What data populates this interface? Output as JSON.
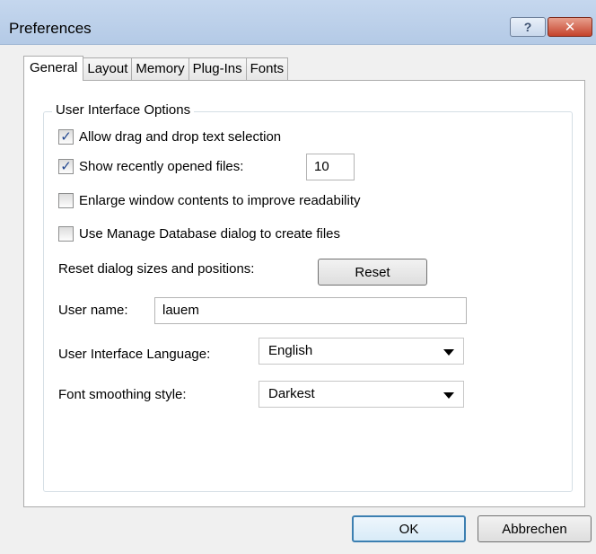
{
  "window": {
    "title": "Preferences"
  },
  "titlebar": {
    "help_icon": "question-mark-icon",
    "close_icon": "close-icon"
  },
  "tabs": [
    {
      "label": "General",
      "active": true
    },
    {
      "label": "Layout",
      "active": false
    },
    {
      "label": "Memory",
      "active": false
    },
    {
      "label": "Plug-Ins",
      "active": false
    },
    {
      "label": "Fonts",
      "active": false
    }
  ],
  "group": {
    "label": "User Interface Options",
    "checkboxes": [
      {
        "label": "Allow drag and drop text selection",
        "checked": true
      },
      {
        "label": "Show recently opened files:",
        "checked": true
      },
      {
        "label": "Enlarge window contents to improve readability",
        "checked": false
      },
      {
        "label": "Use Manage Database dialog to create files",
        "checked": false
      }
    ],
    "recent_files_count": "10",
    "reset": {
      "label": "Reset dialog sizes and positions:",
      "button": "Reset"
    },
    "user_name": {
      "label": "User name:",
      "value": "lauem"
    },
    "language": {
      "label": "User Interface Language:",
      "value": "English"
    },
    "font_smoothing": {
      "label": "Font smoothing style:",
      "value": "Darkest"
    }
  },
  "footer": {
    "ok": "OK",
    "cancel": "Abbrechen"
  }
}
